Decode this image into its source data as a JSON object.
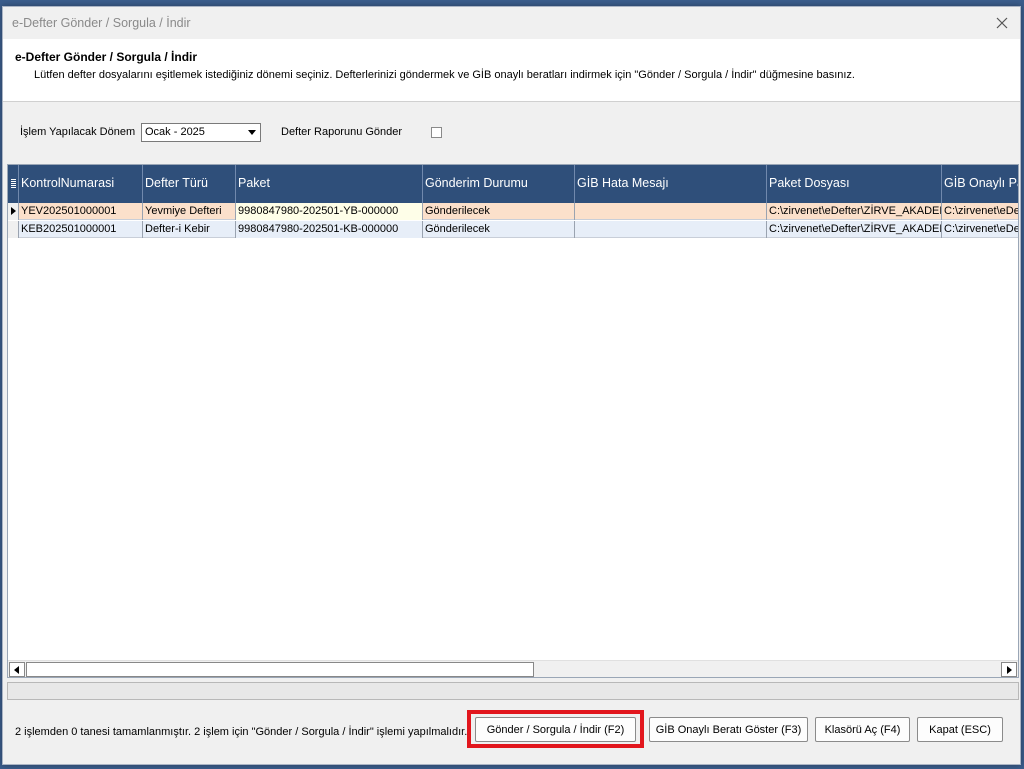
{
  "window": {
    "title": "e-Defter Gönder / Sorgula / İndir"
  },
  "header": {
    "title": "e-Defter Gönder / Sorgula / İndir",
    "description": "Lütfen defter dosyalarını eşitlemek istediğiniz dönemi seçiniz. Defterlerinizi göndermek ve GİB onaylı beratları indirmek için \"Gönder / Sorgula / İndir\" düğmesine basınız."
  },
  "filters": {
    "period_label": "İşlem Yapılacak Dönem",
    "period_value": "Ocak - 2025",
    "report_label": "Defter Raporunu Gönder",
    "report_checked": false
  },
  "grid": {
    "columns": [
      "KontrolNumarasi",
      "Defter Türü",
      "Paket",
      "Gönderim Durumu",
      "GİB Hata Mesajı",
      "Paket Dosyası",
      "GİB Onaylı Pa"
    ],
    "rows": [
      [
        "YEV202501000001",
        "Yevmiye Defteri",
        "9980847980-202501-YB-000000",
        "Gönderilecek",
        "",
        "C:\\zirvenet\\eDefter\\ZİRVE_AKADEM",
        "C:\\zirvenet\\eDe"
      ],
      [
        "KEB202501000001",
        "Defter-i Kebir",
        "9980847980-202501-KB-000000",
        "Gönderilecek",
        "",
        "C:\\zirvenet\\eDefter\\ZİRVE_AKADEM",
        "C:\\zirvenet\\eDe"
      ]
    ]
  },
  "footer": {
    "status": "2 işlemden 0 tanesi tamamlanmıştır. 2 işlem için \"Gönder / Sorgula / İndir\" işlemi yapılmalıdır.",
    "send_button": "Gönder / Sorgula / İndir (F2)",
    "show_berat_button": "GİB Onaylı Beratı Göster (F3)",
    "open_folder_button": "Klasörü Aç (F4)",
    "close_button": "Kapat (ESC)"
  },
  "colors": {
    "header_bg": "#2f4f7a",
    "selected_row": "#fbe0cb",
    "alt_row": "#e7eef8",
    "highlight": "#e2161d"
  }
}
